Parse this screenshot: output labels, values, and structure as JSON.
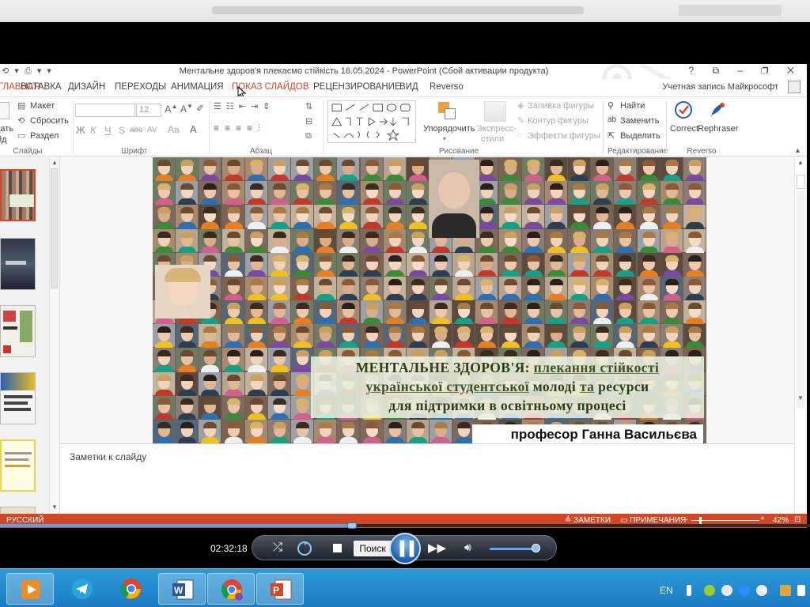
{
  "window": {
    "title": "Ментальне здоров'я плекаємо стійкість 16.05.2024 - PowerPoint (Сбой активации продукта)",
    "account": "Учетная запись Майкрософт"
  },
  "ribbon_tabs": [
    {
      "label": "ГЛАВНАЯ",
      "state": "active"
    },
    {
      "label": "ВСТАВКА"
    },
    {
      "label": "ДИЗАЙН"
    },
    {
      "label": "ПЕРЕХОДЫ"
    },
    {
      "label": "АНИМАЦИЯ"
    },
    {
      "label": "ПОКАЗ СЛАЙДОВ",
      "state": "hover"
    },
    {
      "label": "РЕЦЕНЗИРОВАНИЕ"
    },
    {
      "label": "ВИД"
    },
    {
      "label": "Reverso"
    }
  ],
  "ribbon": {
    "slides": {
      "layout": "Макет",
      "reset": "Сбросить",
      "section": "Раздел",
      "create": "дать",
      "create2": "йд",
      "label": "Слайды"
    },
    "font": {
      "size": "12",
      "bold": "Ж",
      "italic": "К",
      "underline": "Ч",
      "strike": "abc",
      "spacing": "AV",
      "case": "Aa",
      "label": "Шрифт"
    },
    "paragraph": {
      "label": "Абзац"
    },
    "drawing": {
      "arrange": "Упорядочить",
      "styles": "Экспресс-\nстили",
      "styles_a": "Экспресс-",
      "styles_b": "стили",
      "fill": "Заливка фигуры",
      "outline": "Контур фигуры",
      "effects": "Эффекты фигуры",
      "label": "Рисование"
    },
    "editing": {
      "find": "Найти",
      "replace": "Заменить",
      "select": "Выделить",
      "label": "Редактирование"
    },
    "reverso": {
      "correct": "Correct",
      "rephraser": "Rephraser",
      "label": "Reverso"
    }
  },
  "slide": {
    "title_line1_a": "МЕНТАЛЬНЕ ЗДОРОВ'Я: ",
    "title_line1_b": "плекання стійкості",
    "title_line2_a": "української студентської",
    "title_line2_b": " молоді ",
    "title_line2_c": "та",
    "title_line2_d": " ресурси",
    "title_line3": "для підтримки в освітньому процесі",
    "author": "професор Ганна Васильєва"
  },
  "notes_placeholder": "Заметки к слайду",
  "statusbar": {
    "language": "РУССКИЙ",
    "notes": "ЗАМЕТКИ",
    "comments": "ПРИМЕЧАНИЯ",
    "zoom": "42%",
    "zoom_level": 0.12
  },
  "media": {
    "timecode": "02:32:18",
    "search_label": "Поиск",
    "progress": 0.435,
    "volume": 0.95
  },
  "taskbar": {
    "apps": [
      "media-player",
      "telegram",
      "chrome",
      "word",
      "chrome-profile",
      "powerpoint"
    ],
    "language": "EN"
  },
  "colors": {
    "accent": "#d24726",
    "taskbar": "#1b7cc4",
    "title_text": "#2e3d1a"
  }
}
